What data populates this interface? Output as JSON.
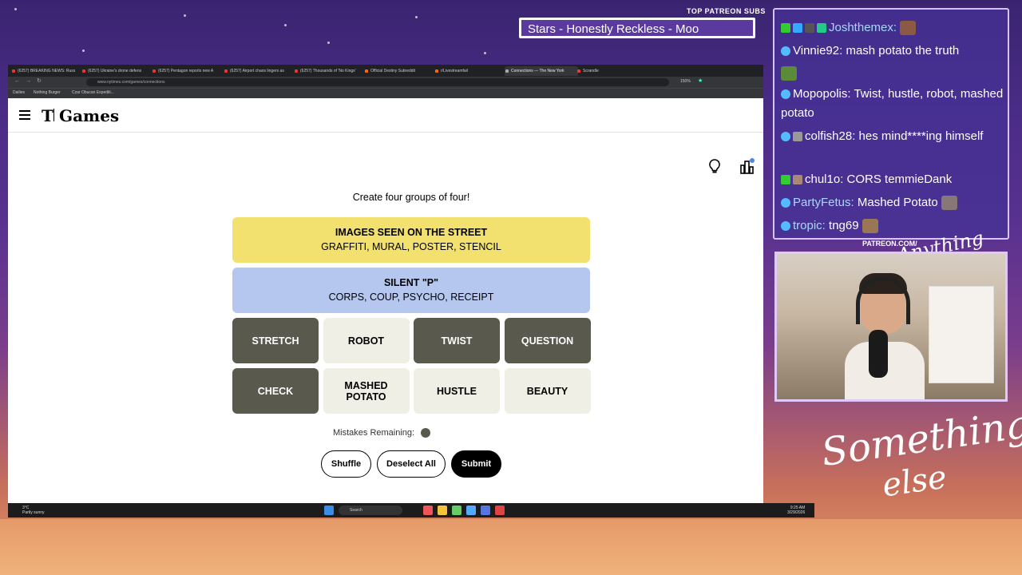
{
  "overlay": {
    "patreon_label": "TOP PATREON SUBS",
    "song": "Stars - Honestly Reckless - Moo"
  },
  "browser": {
    "tabs": [
      {
        "label": "(6257) BREAKING NEWS: Russ"
      },
      {
        "label": "(6257) Ukraine's drone defens"
      },
      {
        "label": "(6257) Pentagon reports new A"
      },
      {
        "label": "(6257) Airport chaos lingers as"
      },
      {
        "label": "(6257) Thousands of 'No Kings'"
      },
      {
        "label": "Official Destiny Subreddit"
      },
      {
        "label": "r/Livestreamfail"
      },
      {
        "label": "Connections — The New York"
      },
      {
        "label": "Scrandle"
      }
    ],
    "url": "www.nytimes.com/games/connections",
    "zoom": "150%",
    "bookmarks": [
      "Dailies",
      "Nothing Burger",
      "Czar Obucan Expediti..."
    ]
  },
  "nyt": {
    "brand_t": "T",
    "brand_games": "Games",
    "instruction": "Create four groups of four!",
    "groups": [
      {
        "title": "IMAGES SEEN ON THE STREET",
        "words": "GRAFFITI, MURAL, POSTER, STENCIL",
        "color": "#f2e06f"
      },
      {
        "title": "SILENT \"P\"",
        "words": "CORPS, COUP, PSYCHO, RECEIPT",
        "color": "#b5c7ee"
      }
    ],
    "tiles": [
      {
        "label": "STRETCH",
        "selected": true
      },
      {
        "label": "ROBOT",
        "selected": false
      },
      {
        "label": "TWIST",
        "selected": true
      },
      {
        "label": "QUESTION",
        "selected": true
      },
      {
        "label": "CHECK",
        "selected": true
      },
      {
        "label": "MASHED POTATO",
        "selected": false
      },
      {
        "label": "HUSTLE",
        "selected": false
      },
      {
        "label": "BEAUTY",
        "selected": false
      }
    ],
    "mistakes_label": "Mistakes Remaining:",
    "mistakes_remaining": 1,
    "buttons": {
      "shuffle": "Shuffle",
      "deselect": "Deselect All",
      "submit": "Submit"
    }
  },
  "taskbar": {
    "weather_temp": "3°C",
    "weather_desc": "Partly sunny",
    "search": "Search",
    "time": "9:25 AM",
    "date": "3/29/2026"
  },
  "chat": [
    {
      "user": "Joshthemex:",
      "text": ""
    },
    {
      "user": "Vinnie92:",
      "text": " mash potato the truth"
    },
    {
      "user": "Mopopolis:",
      "text": " Twist, hustle, robot, mashed potato"
    },
    {
      "user": "colfish28:",
      "text": " hes mind****ing himself"
    },
    {
      "user": "chul1o:",
      "text": " CORS temmieDank"
    },
    {
      "user": "PartyFetus:",
      "text": " Mashed Potato"
    },
    {
      "user": "tropic:",
      "text": " tng69"
    }
  ],
  "cam": {
    "label": "PATREON.COM/",
    "script": "Anything Else"
  },
  "branding": {
    "line1": "Something",
    "line2": "else"
  }
}
